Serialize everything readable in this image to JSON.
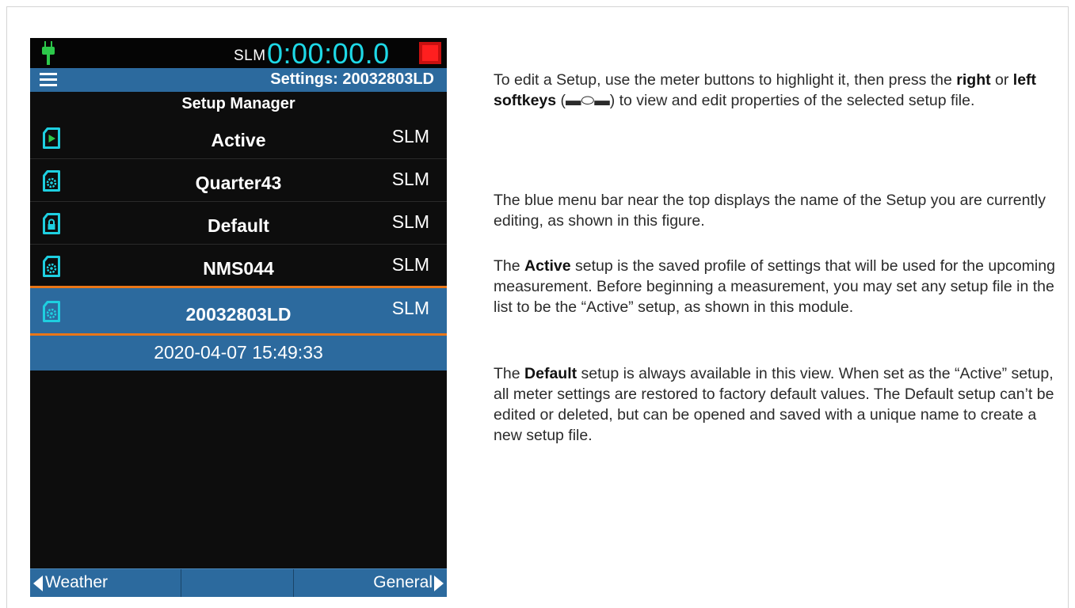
{
  "device": {
    "status": {
      "mode_label": "SLM",
      "timer": "0:00:00.0"
    },
    "settings_bar": {
      "title": "Settings: 20032803LD"
    },
    "manager_title": "Setup Manager",
    "setups": [
      {
        "name": "Active",
        "mode": "SLM",
        "icon": "play-file-icon"
      },
      {
        "name": "Quarter43",
        "mode": "SLM",
        "icon": "gear-file-icon"
      },
      {
        "name": "Default",
        "mode": "SLM",
        "icon": "lock-file-icon"
      },
      {
        "name": "NMS044",
        "mode": "SLM",
        "icon": "gear-file-icon"
      },
      {
        "name": "20032803LD",
        "mode": "SLM",
        "icon": "gear-file-icon",
        "selected": true
      }
    ],
    "selected_date": "2020-04-07 15:49:33",
    "softkeys": {
      "left": "Weather",
      "middle": "",
      "right": "General"
    },
    "colors": {
      "accent_blue": "#2c6a9e",
      "timer_cyan": "#1ed8e6",
      "highlight_orange": "#e97618",
      "icon_cyan": "#1ecfe0",
      "play_green": "#2cc84a",
      "record_red": "#ff1f1f"
    }
  },
  "help": {
    "p1": {
      "a": "To edit a Setup, use the meter buttons to highlight it, then press the ",
      "b1": "right",
      "c": " or ",
      "b2": "left softkeys",
      "d": " (",
      "keys": "▬⬭▬",
      "e": ") to view and edit properties of the selected setup file."
    },
    "p2": "The blue menu bar near the top displays the name of the Setup you are currently editing, as shown in this figure.",
    "p3": {
      "b": "Active",
      "rest": " setup is the saved profile of settings that will be used for the upcoming measurement. Before beginning a measurement, you may set any setup file in the list to be the “Active” setup, as shown in this module.",
      "lead": "The "
    },
    "p4": {
      "lead": "The ",
      "b": "Default",
      "rest": " setup is always available in this view. When set as the “Active” setup, all meter settings are restored to factory default values. The Default setup can’t be edited or deleted, but can be opened and saved with a unique name to create a new setup file."
    }
  }
}
